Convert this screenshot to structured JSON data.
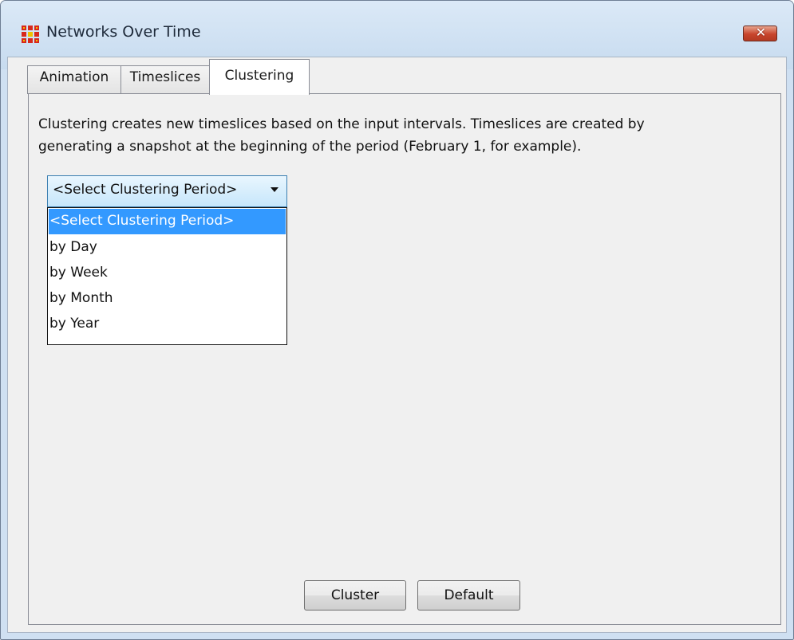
{
  "window": {
    "title": "Networks Over Time",
    "app_icon": "network-grid-icon",
    "close_icon": "close-x-icon"
  },
  "tabs": [
    {
      "label": "Animation",
      "active": false
    },
    {
      "label": "Timeslices",
      "active": false
    },
    {
      "label": "Clustering",
      "active": true
    }
  ],
  "clustering": {
    "description_lines": [
      "Clustering creates new timeslices based on the input intervals. Timeslices are created by",
      "generating a snapshot at the beginning of the period (February 1, for example)."
    ],
    "period_select": {
      "selected": "<Select Clustering Period>",
      "options": [
        "<Select Clustering Period>",
        "by Day",
        "by Week",
        "by Month",
        "by Year"
      ],
      "highlighted_index": 0
    },
    "buttons": {
      "cluster": "Cluster",
      "default": "Default"
    }
  },
  "colors": {
    "accent_highlight": "#3399ff",
    "close_button": "#c8452c",
    "app_icon": "#d8281c"
  }
}
